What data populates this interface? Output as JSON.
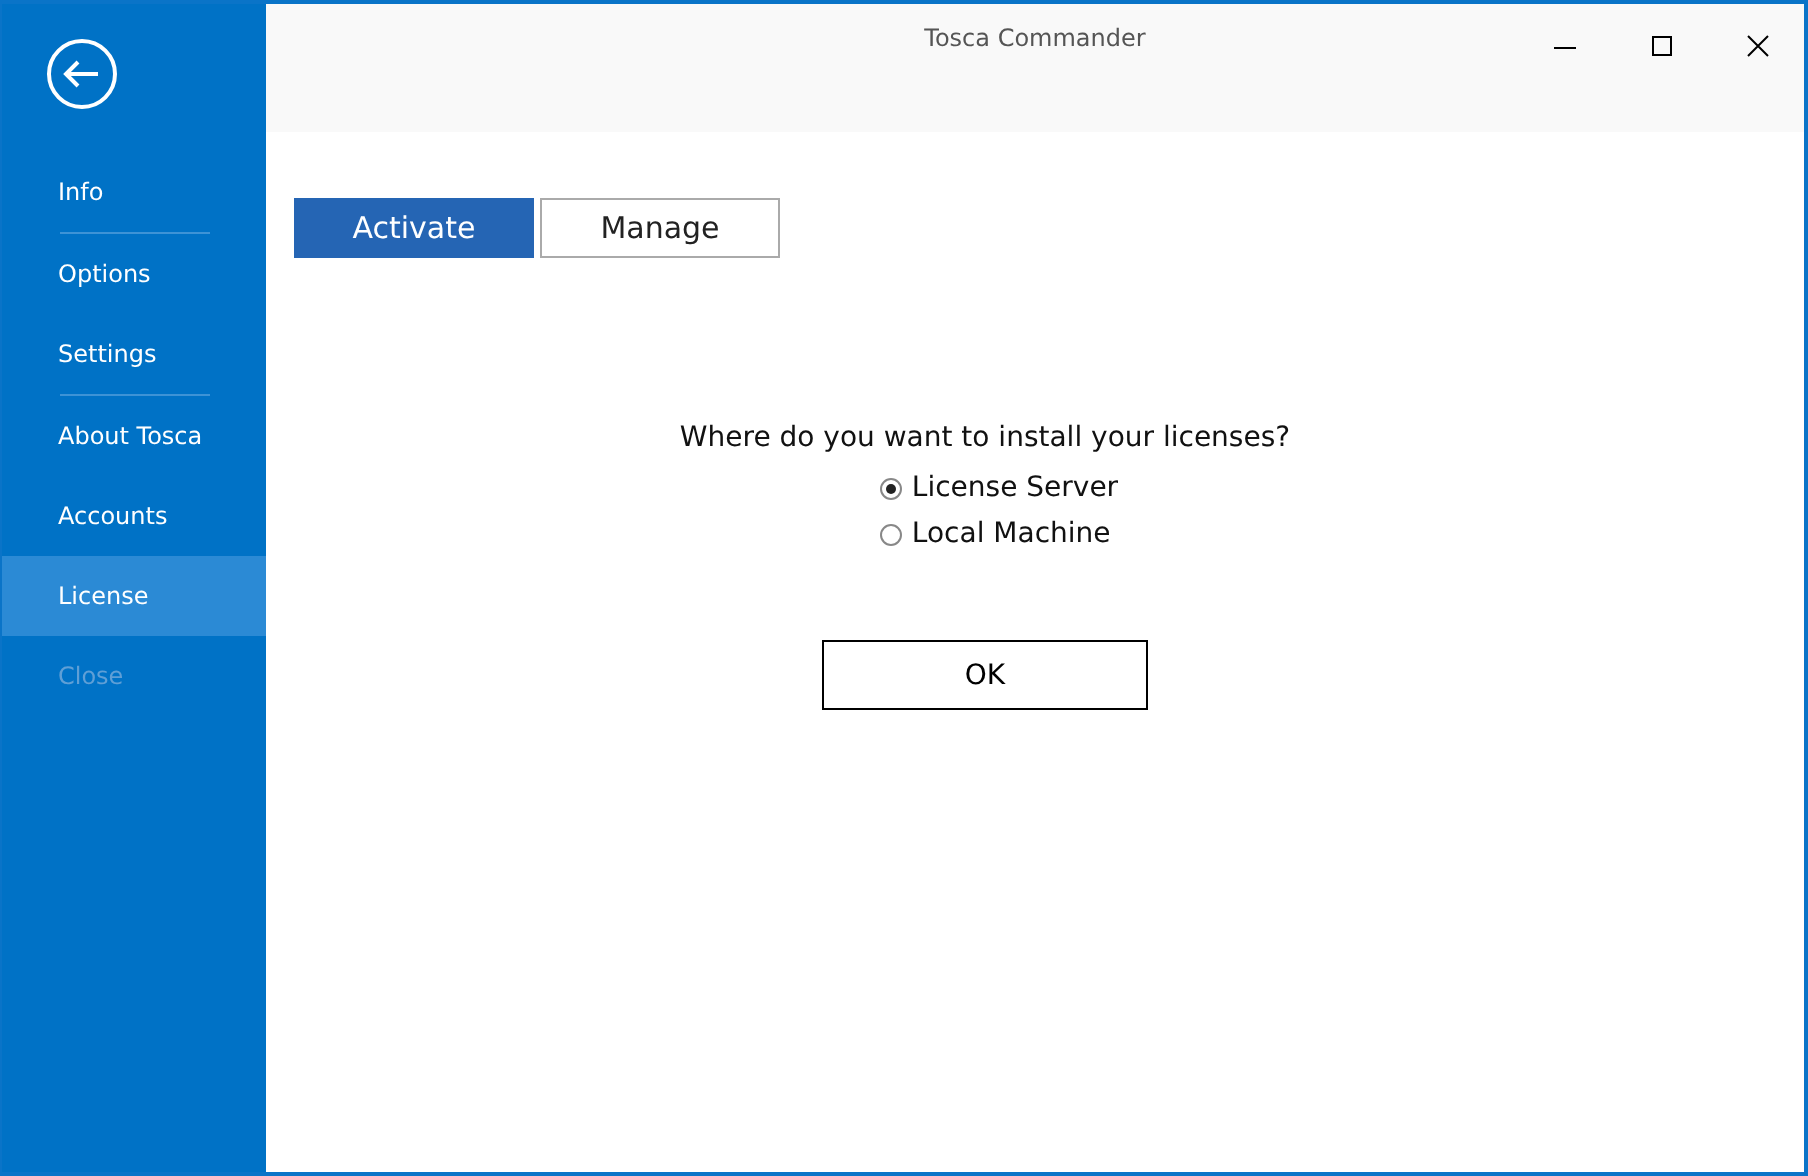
{
  "window": {
    "title": "Tosca Commander"
  },
  "sidebar": {
    "items": [
      {
        "label": "Info",
        "selected": false,
        "disabled": false,
        "separator_after": true
      },
      {
        "label": "Options",
        "selected": false,
        "disabled": false,
        "separator_after": false
      },
      {
        "label": "Settings",
        "selected": false,
        "disabled": false,
        "separator_after": true
      },
      {
        "label": "About Tosca",
        "selected": false,
        "disabled": false,
        "separator_after": false
      },
      {
        "label": "Accounts",
        "selected": false,
        "disabled": false,
        "separator_after": false
      },
      {
        "label": "License",
        "selected": true,
        "disabled": false,
        "separator_after": false
      },
      {
        "label": "Close",
        "selected": false,
        "disabled": true,
        "separator_after": false
      }
    ]
  },
  "tabs": [
    {
      "label": "Activate",
      "selected": true
    },
    {
      "label": "Manage",
      "selected": false
    }
  ],
  "question": "Where do you want to install your licenses?",
  "options": [
    {
      "label": "License Server",
      "selected": true
    },
    {
      "label": "Local Machine",
      "selected": false
    }
  ],
  "buttons": [
    "OK"
  ]
}
